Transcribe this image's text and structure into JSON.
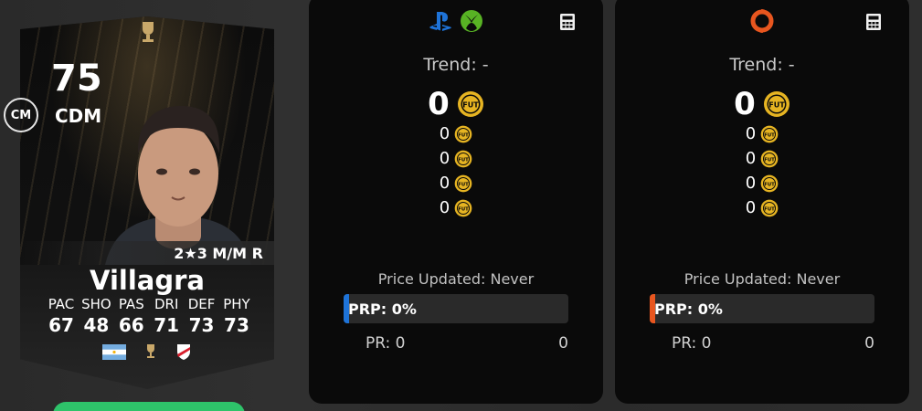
{
  "card": {
    "rating": "75",
    "position": "CDM",
    "alt_position": "CM",
    "skills_line": "2★3 M/M R",
    "name": "Villagra",
    "stats": [
      {
        "label": "PAC",
        "value": "67"
      },
      {
        "label": "SHO",
        "value": "48"
      },
      {
        "label": "PAS",
        "value": "66"
      },
      {
        "label": "DRI",
        "value": "71"
      },
      {
        "label": "DEF",
        "value": "73"
      },
      {
        "label": "PHY",
        "value": "73"
      }
    ],
    "nation_icon": "argentina-flag-icon",
    "league_icon": "libertadores-logo-icon",
    "club_icon": "river-plate-crest-icon"
  },
  "console_panel": {
    "platform_icons": [
      "playstation-icon",
      "xbox-icon"
    ],
    "trend": "Trend: -",
    "main_price": "0",
    "prices": [
      "0",
      "0",
      "0",
      "0"
    ],
    "updated": "Price Updated: Never",
    "prp": "PRP: 0%",
    "pr_left": "PR: 0",
    "pr_right": "0",
    "accent": "#1e73d8"
  },
  "pc_panel": {
    "platform_icons": [
      "origin-icon"
    ],
    "trend": "Trend: -",
    "main_price": "0",
    "prices": [
      "0",
      "0",
      "0",
      "0"
    ],
    "updated": "Price Updated: Never",
    "prp": "PRP: 0%",
    "pr_left": "PR: 0",
    "pr_right": "0",
    "accent": "#e8561f"
  },
  "colors": {
    "coin_gold": "#e6b422",
    "action_green": "#2ec36a"
  }
}
